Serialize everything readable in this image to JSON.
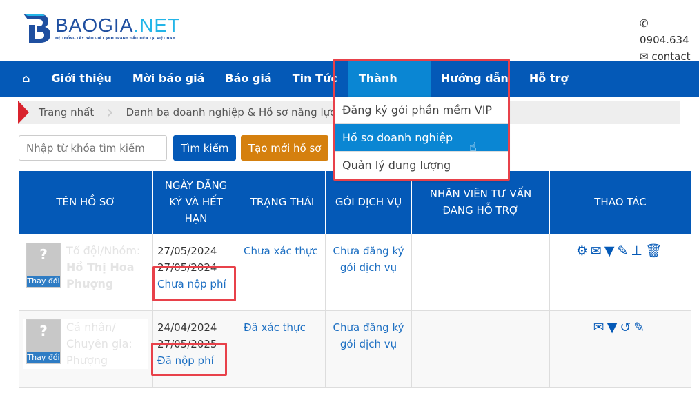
{
  "header": {
    "logo_text": "BAOGIA.NET",
    "logo_tagline": "HỆ THỐNG LẤY BÁO GIÁ CẠNH TRANH ĐẦU TIÊN TẠI VIỆT NAM",
    "phone": "0904.634",
    "contact": "contact"
  },
  "nav": {
    "items": [
      "Giới thiệu",
      "Mời báo giá",
      "Báo giá",
      "Tin Tức",
      "Thành viên",
      "Hướng dẫn",
      "Hỗ trợ"
    ],
    "active": "Thành viên"
  },
  "dropdown": {
    "items": [
      "Đăng ký gói phần mềm VIP",
      "Hồ sơ doanh nghiệp",
      "Quản lý dung lượng"
    ],
    "selected": "Hồ sơ doanh nghiệp"
  },
  "breadcrumb": [
    "Trang nhất",
    "Danh bạ doanh nghiệp & Hồ sơ năng lực"
  ],
  "search": {
    "placeholder": "Nhập từ khóa tìm kiếm",
    "search_label": "Tìm kiếm",
    "create_label": "Tạo mới hồ sơ"
  },
  "table": {
    "headers": [
      "TÊN HỒ SƠ",
      "NGÀY ĐĂNG KÝ VÀ HẾT HẠN",
      "TRẠNG THÁI",
      "GÓI DỊCH VỤ",
      "NHÂN VIÊN TƯ VẤN ĐANG HỖ TRỢ",
      "THAO TÁC"
    ],
    "change_label": "Thay đổi",
    "rows": [
      {
        "type": "Tổ đội/Nhóm:",
        "name": "Hồ Thị Hoa Phượng",
        "registered": "27/05/2024",
        "expires": "27/05/2024",
        "fee": "Chưa nộp phí",
        "status": "Chưa xác thực",
        "package": "Chưa đăng ký gói dịch vụ",
        "staff": "",
        "actions": [
          "gears-icon",
          "envelope-icon",
          "filter-icon",
          "edit-icon",
          "sitemap-icon",
          "trash-icon"
        ]
      },
      {
        "type": "Cá nhân/ Chuyên gia:",
        "name": "Phượng",
        "registered": "24/04/2024",
        "expires": "27/05/2025",
        "fee": "Đã nộp phí",
        "status": "Đã xác thực",
        "package": "Chưa đăng ký gói dịch vụ",
        "staff": "",
        "actions": [
          "envelope-icon",
          "filter-icon",
          "history-icon",
          "edit-icon"
        ]
      }
    ]
  },
  "colors": {
    "nav": "#0459b7",
    "nav_active": "#0a86d3",
    "highlight": "#e8414a",
    "create_button": "#d5800e"
  }
}
